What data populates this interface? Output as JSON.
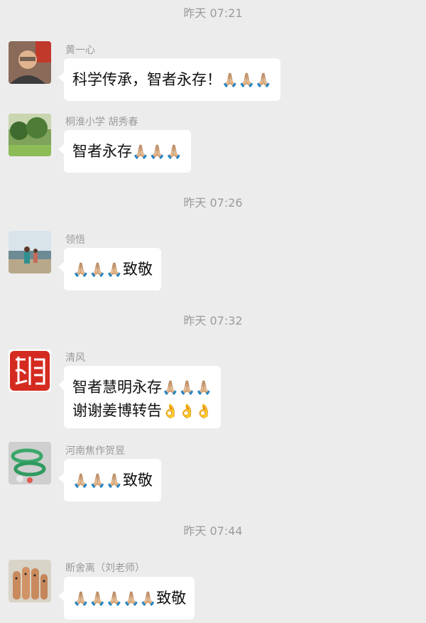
{
  "messages": [
    {
      "time": "昨天 07:21"
    },
    {
      "sender": "黄一心",
      "avatar_icon": "man-portrait-avatar-icon",
      "lines": [
        {
          "text": "科学传承，智者永存！",
          "emoji": "🙏🏼🙏🏼🙏🏼"
        }
      ]
    },
    {
      "sender": "桐淮小学 胡秀春",
      "avatar_icon": "trees-landscape-avatar-icon",
      "lines": [
        {
          "text": "智者永存",
          "emoji": "🙏🏼🙏🏼🙏🏼"
        }
      ]
    },
    {
      "time": "昨天 07:26"
    },
    {
      "sender": "领悟",
      "avatar_icon": "beach-photo-avatar-icon",
      "lines": [
        {
          "emoji": "🙏🏼🙏🏼🙏🏼",
          "text": "致敬"
        }
      ]
    },
    {
      "time": "昨天 07:32"
    },
    {
      "sender": "清风",
      "avatar_icon": "red-seal-stamp-avatar-icon",
      "lines": [
        {
          "text": "智者慧明永存",
          "emoji": "🙏🏼🙏🏼🙏🏼"
        },
        {
          "text": "谢谢姜博转告",
          "emoji": "👌👌👌"
        }
      ]
    },
    {
      "sender": "河南焦作贺昱",
      "avatar_icon": "jade-bracelet-avatar-icon",
      "lines": [
        {
          "emoji": "🙏🏼🙏🏼🙏🏼",
          "text": "致敬"
        }
      ]
    },
    {
      "time": "昨天 07:44"
    },
    {
      "sender": "断舍离（刘老师）",
      "avatar_icon": "finger-faces-avatar-icon",
      "lines": [
        {
          "emoji": "🙏🏼🙏🏼🙏🏼🙏🏼🙏🏼",
          "text": "致敬"
        }
      ]
    }
  ]
}
